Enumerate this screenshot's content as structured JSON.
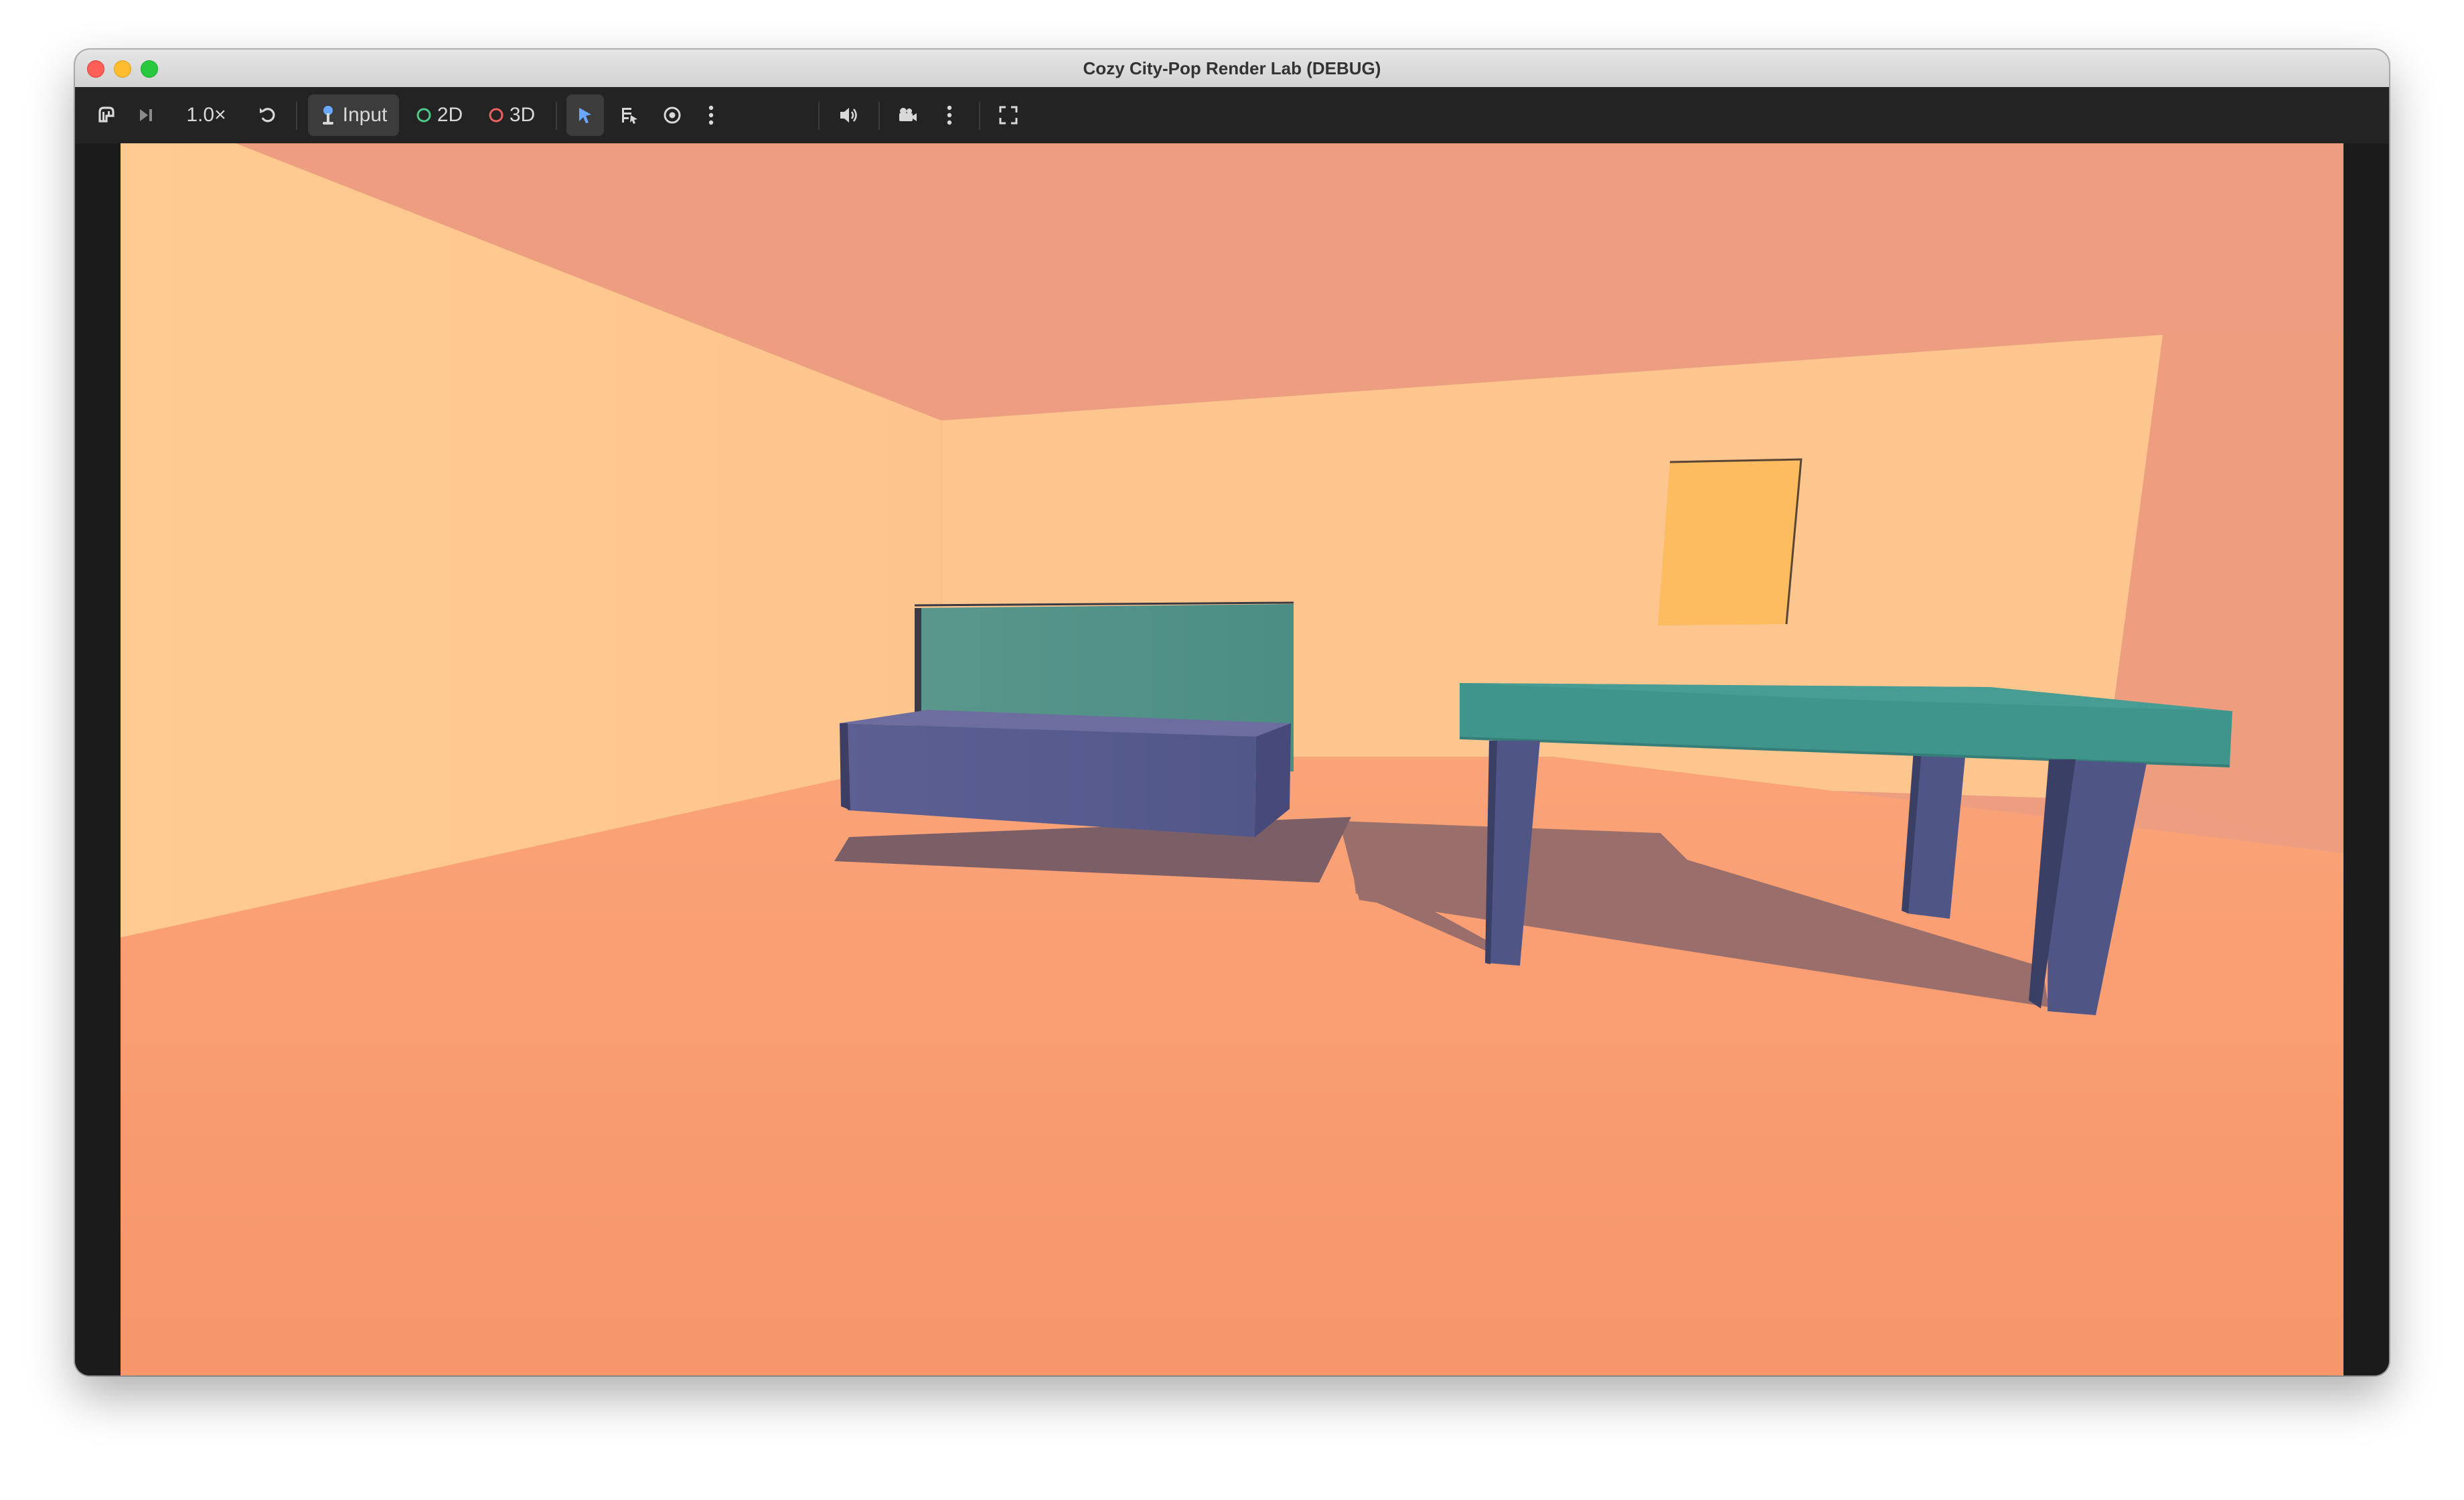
{
  "window": {
    "title": "Cozy City-Pop Render Lab (DEBUG)"
  },
  "toolbar": {
    "speed": "1.0×",
    "input_label": "Input",
    "mode_2d_label": "2D",
    "mode_3d_label": "3D"
  },
  "colors": {
    "ceiling": "#ee9e80",
    "left_wall": "#fec78f",
    "back_wall": "#fdc68e",
    "floor": "#f9996c",
    "right_wall": "#ee9d7f",
    "sofa_back": "#55918a",
    "sofa_seat": "#585c8c",
    "table_top": "#3f948c",
    "table_leg": "#4f5686",
    "picture_frame": "#febd60",
    "shadow": "#6e5865",
    "indicator_2d": "#4fc98a",
    "indicator_3d": "#f06060",
    "select_active": "#6aa8ff"
  }
}
